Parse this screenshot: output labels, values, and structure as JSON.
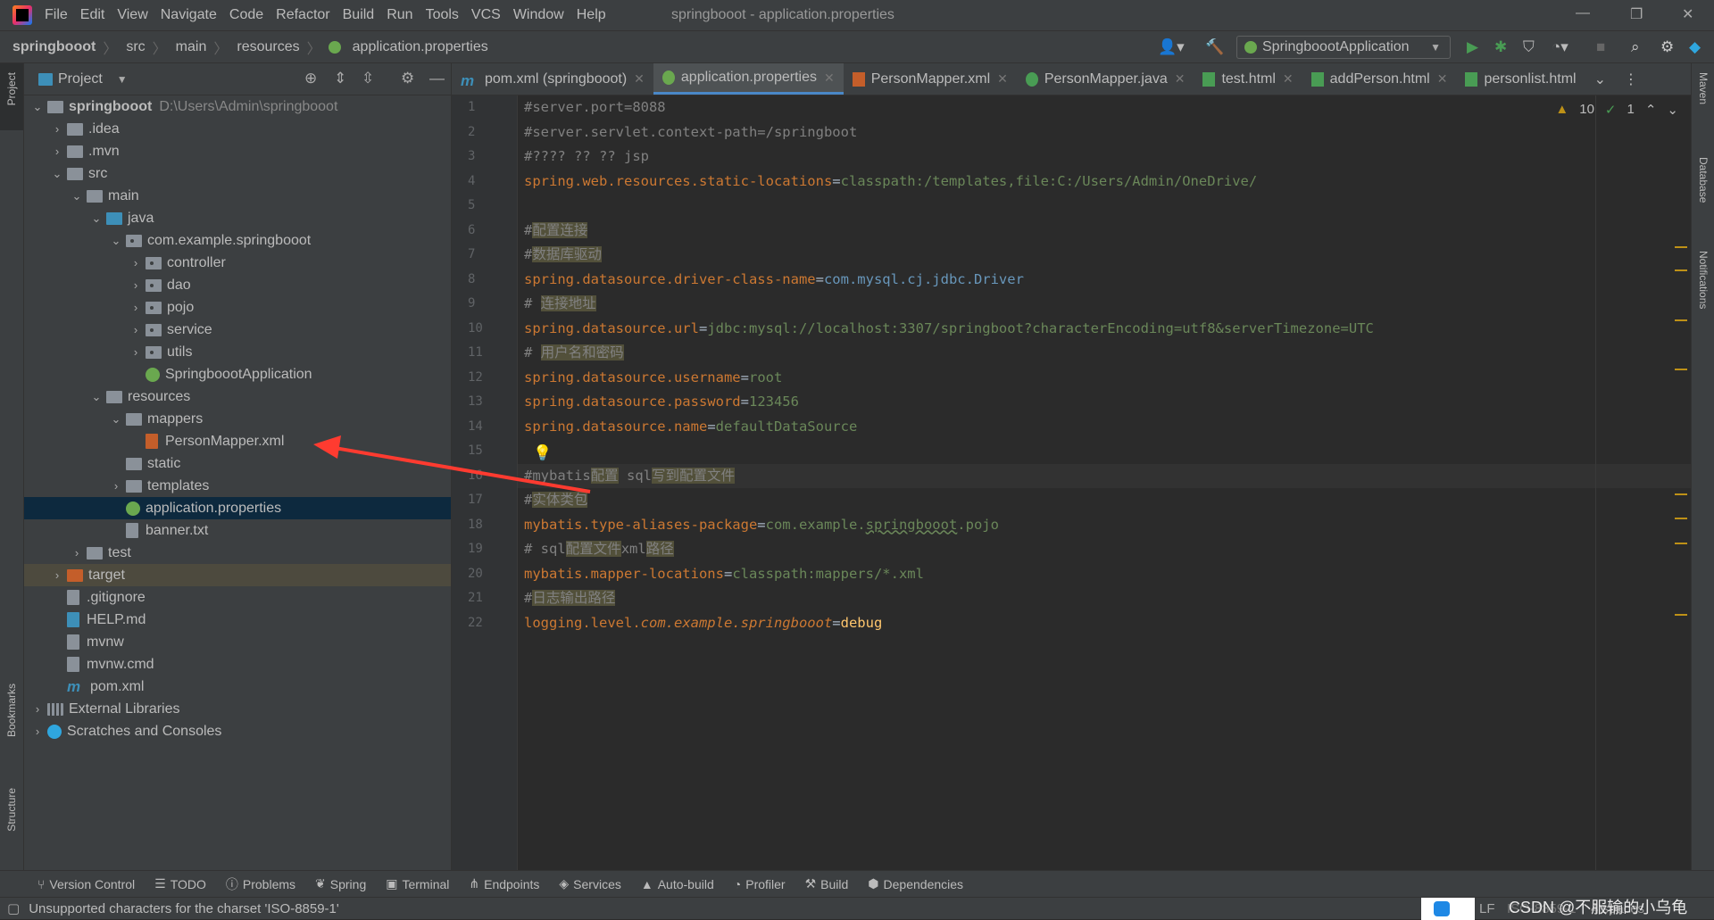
{
  "menu": [
    "File",
    "Edit",
    "View",
    "Navigate",
    "Code",
    "Refactor",
    "Build",
    "Run",
    "Tools",
    "VCS",
    "Window",
    "Help"
  ],
  "window_title": "springbooot - application.properties",
  "breadcrumb": [
    "springbooot",
    "src",
    "main",
    "resources",
    "application.properties"
  ],
  "run_config": "SpringboootApplication",
  "project_panel": {
    "title": "Project",
    "tree": [
      {
        "label": "springbooot",
        "extra": "D:\\Users\\Admin\\springbooot",
        "level": 0,
        "chev": "down",
        "icon": "module",
        "bold": true
      },
      {
        "label": ".idea",
        "level": 1,
        "chev": "right",
        "icon": "folder"
      },
      {
        "label": ".mvn",
        "level": 1,
        "chev": "right",
        "icon": "folder"
      },
      {
        "label": "src",
        "level": 1,
        "chev": "down",
        "icon": "folder"
      },
      {
        "label": "main",
        "level": 2,
        "chev": "down",
        "icon": "folder"
      },
      {
        "label": "java",
        "level": 3,
        "chev": "down",
        "icon": "source-folder"
      },
      {
        "label": "com.example.springbooot",
        "level": 4,
        "chev": "down",
        "icon": "package"
      },
      {
        "label": "controller",
        "level": 5,
        "chev": "right",
        "icon": "package"
      },
      {
        "label": "dao",
        "level": 5,
        "chev": "right",
        "icon": "package"
      },
      {
        "label": "pojo",
        "level": 5,
        "chev": "right",
        "icon": "package"
      },
      {
        "label": "service",
        "level": 5,
        "chev": "right",
        "icon": "package"
      },
      {
        "label": "utils",
        "level": 5,
        "chev": "right",
        "icon": "package"
      },
      {
        "label": "SpringboootApplication",
        "level": 5,
        "chev": "",
        "icon": "spring-class"
      },
      {
        "label": "resources",
        "level": 3,
        "chev": "down",
        "icon": "resources-folder"
      },
      {
        "label": "mappers",
        "level": 4,
        "chev": "down",
        "icon": "folder"
      },
      {
        "label": "PersonMapper.xml",
        "level": 5,
        "chev": "",
        "icon": "xml-file"
      },
      {
        "label": "static",
        "level": 4,
        "chev": "",
        "icon": "folder"
      },
      {
        "label": "templates",
        "level": 4,
        "chev": "right",
        "icon": "folder"
      },
      {
        "label": "application.properties",
        "level": 4,
        "chev": "",
        "icon": "spring-properties",
        "selected": true
      },
      {
        "label": "banner.txt",
        "level": 4,
        "chev": "",
        "icon": "text-file"
      },
      {
        "label": "test",
        "level": 2,
        "chev": "right",
        "icon": "folder"
      },
      {
        "label": "target",
        "level": 1,
        "chev": "right",
        "icon": "excluded-folder",
        "excluded": true
      },
      {
        "label": ".gitignore",
        "level": 1,
        "chev": "",
        "icon": "ignore-file"
      },
      {
        "label": "HELP.md",
        "level": 1,
        "chev": "",
        "icon": "markdown-file"
      },
      {
        "label": "mvnw",
        "level": 1,
        "chev": "",
        "icon": "shell-file"
      },
      {
        "label": "mvnw.cmd",
        "level": 1,
        "chev": "",
        "icon": "text-file"
      },
      {
        "label": "pom.xml",
        "level": 1,
        "chev": "",
        "icon": "maven-file"
      },
      {
        "label": "External Libraries",
        "level": 0,
        "chev": "right",
        "icon": "libraries"
      },
      {
        "label": "Scratches and Consoles",
        "level": 0,
        "chev": "right",
        "icon": "scratches"
      }
    ]
  },
  "tabs": [
    {
      "label": "pom.xml (springbooot)",
      "icon": "maven-file"
    },
    {
      "label": "application.properties",
      "icon": "spring-properties",
      "active": true
    },
    {
      "label": "PersonMapper.xml",
      "icon": "xml-file"
    },
    {
      "label": "PersonMapper.java",
      "icon": "interface-file"
    },
    {
      "label": "test.html",
      "icon": "html-file"
    },
    {
      "label": "addPerson.html",
      "icon": "html-file"
    },
    {
      "label": "personlist.html",
      "icon": "html-file"
    }
  ],
  "inspections": {
    "warnings": "10",
    "ok": "1"
  },
  "editor": {
    "current_line": 16,
    "lines": [
      [
        {
          "t": "#server.port=8088",
          "k": "comment"
        }
      ],
      [
        {
          "t": "#server.servlet.context-path=/springboot",
          "k": "comment"
        }
      ],
      [
        {
          "t": "#???? ?? ?? jsp",
          "k": "comment"
        }
      ],
      [
        {
          "t": "spring.web.resources.static-locations",
          "k": "key"
        },
        {
          "t": "=",
          "k": "sep"
        },
        {
          "t": "classpath:/templates,file:C:/Users/Admin/OneDrive/",
          "k": "value"
        }
      ],
      [],
      [
        {
          "t": "#",
          "k": "comment"
        },
        {
          "t": "配置连接",
          "k": "hl"
        }
      ],
      [
        {
          "t": "#",
          "k": "comment"
        },
        {
          "t": "数据库驱动",
          "k": "hl"
        }
      ],
      [
        {
          "t": "spring.datasource.driver-class-name",
          "k": "key"
        },
        {
          "t": "=",
          "k": "sep"
        },
        {
          "t": "com.mysql.cj.jdbc.Driver",
          "k": "class"
        }
      ],
      [
        {
          "t": "# ",
          "k": "comment"
        },
        {
          "t": "连接地址",
          "k": "hl"
        }
      ],
      [
        {
          "t": "spring.datasource.url",
          "k": "key"
        },
        {
          "t": "=",
          "k": "sep"
        },
        {
          "t": "jdbc:mysql://localhost:3307/springboot?characterEncoding=utf8&serverTimezone=UTC",
          "k": "value"
        }
      ],
      [
        {
          "t": "# ",
          "k": "comment"
        },
        {
          "t": "用户名和密码",
          "k": "hl"
        }
      ],
      [
        {
          "t": "spring.datasource.username",
          "k": "key"
        },
        {
          "t": "=",
          "k": "sep"
        },
        {
          "t": "root",
          "k": "value"
        }
      ],
      [
        {
          "t": "spring.datasource.password",
          "k": "key"
        },
        {
          "t": "=",
          "k": "sep"
        },
        {
          "t": "123456",
          "k": "value"
        }
      ],
      [
        {
          "t": "spring.datasource.name",
          "k": "key"
        },
        {
          "t": "=",
          "k": "sep"
        },
        {
          "t": "defaultDataSource",
          "k": "value"
        }
      ],
      [],
      [
        {
          "t": "#mybatis",
          "k": "comment"
        },
        {
          "t": "配置",
          "k": "hl"
        },
        {
          "t": " sql",
          "k": "comment"
        },
        {
          "t": "写到配置文件",
          "k": "hl"
        }
      ],
      [
        {
          "t": "#",
          "k": "comment"
        },
        {
          "t": "实体类包",
          "k": "hl"
        }
      ],
      [
        {
          "t": "mybatis.type-aliases-package",
          "k": "key"
        },
        {
          "t": "=",
          "k": "sep"
        },
        {
          "t": "com.example.",
          "k": "value"
        },
        {
          "t": "springbooot",
          "k": "typo"
        },
        {
          "t": ".pojo",
          "k": "value"
        }
      ],
      [
        {
          "t": "# sql",
          "k": "comment"
        },
        {
          "t": "配置文件",
          "k": "hl"
        },
        {
          "t": "xml",
          "k": "comment"
        },
        {
          "t": "路径",
          "k": "hl"
        }
      ],
      [
        {
          "t": "mybatis.mapper-locations",
          "k": "key"
        },
        {
          "t": "=",
          "k": "sep"
        },
        {
          "t": "classpath:mappers/*.xml",
          "k": "value"
        }
      ],
      [
        {
          "t": "#",
          "k": "comment"
        },
        {
          "t": "日志输出路径",
          "k": "hl"
        }
      ],
      [
        {
          "t": "logging.level.",
          "k": "key"
        },
        {
          "t": "com.example.springbooot",
          "k": "italic"
        },
        {
          "t": "=",
          "k": "sep"
        },
        {
          "t": "debug",
          "k": "debug"
        }
      ]
    ]
  },
  "left_stripe": [
    "Project",
    "Bookmarks",
    "Structure"
  ],
  "right_stripe": [
    "Maven",
    "Database",
    "Notifications"
  ],
  "bottom_tools": [
    "Version Control",
    "TODO",
    "Problems",
    "Spring",
    "Terminal",
    "Endpoints",
    "Services",
    "Auto-build",
    "Profiler",
    "Build",
    "Dependencies"
  ],
  "status": {
    "message": "Unsupported characters for the charset 'ISO-8859-1'",
    "line_sep": "LF",
    "encoding": "ISO-8859-1",
    "indent": "4 spaces"
  },
  "watermark": "CSDN @不服输的小乌龟",
  "annotation_color": "#ff3b30"
}
